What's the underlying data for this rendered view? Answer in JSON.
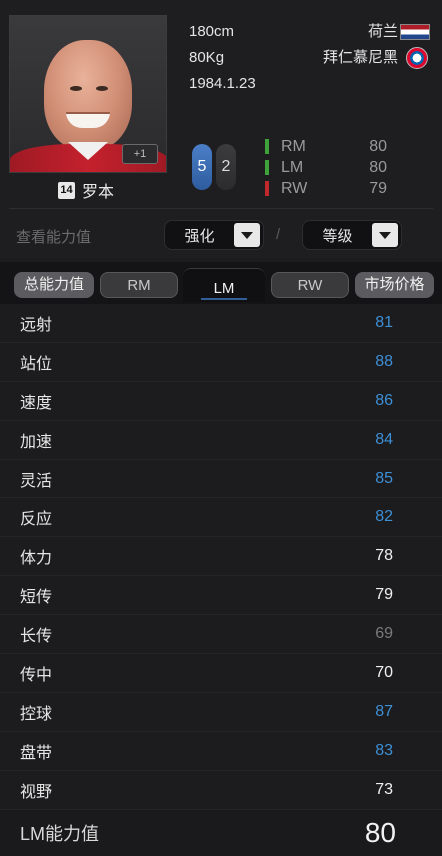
{
  "player": {
    "height": "180cm",
    "weight": "80Kg",
    "birthdate": "1984.1.23",
    "nation": "荷兰",
    "club": "拜仁慕尼黑",
    "number": "14",
    "name": "罗本",
    "plus_badge": "+1",
    "weak_foot_left": "5",
    "weak_foot_right": "2"
  },
  "positions": [
    {
      "name": "RM",
      "value": "80",
      "color": "#3fa33c"
    },
    {
      "name": "LM",
      "value": "80",
      "color": "#3fa33c"
    },
    {
      "name": "RW",
      "value": "79",
      "color": "#c0282b"
    }
  ],
  "filters": {
    "label": "查看能力值",
    "enhance": "强化",
    "grade": "等级",
    "separator": "/"
  },
  "tabs": [
    "总能力值",
    "RM",
    "LM",
    "RW",
    "市场价格"
  ],
  "active_tab": "LM",
  "stats": [
    {
      "name": "远射",
      "value": "81",
      "color": "#3d8fd6"
    },
    {
      "name": "站位",
      "value": "88",
      "color": "#3d8fd6"
    },
    {
      "name": "速度",
      "value": "86",
      "color": "#3d8fd6"
    },
    {
      "name": "加速",
      "value": "84",
      "color": "#3d8fd6"
    },
    {
      "name": "灵活",
      "value": "85",
      "color": "#3d8fd6"
    },
    {
      "name": "反应",
      "value": "82",
      "color": "#3d8fd6"
    },
    {
      "name": "体力",
      "value": "78",
      "color": "#f0f0f0"
    },
    {
      "name": "短传",
      "value": "79",
      "color": "#f0f0f0"
    },
    {
      "name": "长传",
      "value": "69",
      "color": "#7a7a7c"
    },
    {
      "name": "传中",
      "value": "70",
      "color": "#f0f0f0"
    },
    {
      "name": "控球",
      "value": "87",
      "color": "#3d8fd6"
    },
    {
      "name": "盘带",
      "value": "83",
      "color": "#3d8fd6"
    },
    {
      "name": "视野",
      "value": "73",
      "color": "#f0f0f0"
    }
  ],
  "total": {
    "label": "LM能力值",
    "value": "80"
  },
  "icons": {
    "flag": "netherlands-flag-icon",
    "club": "bayern-munich-logo-icon",
    "dropdown": "dropdown-arrow-icon"
  }
}
